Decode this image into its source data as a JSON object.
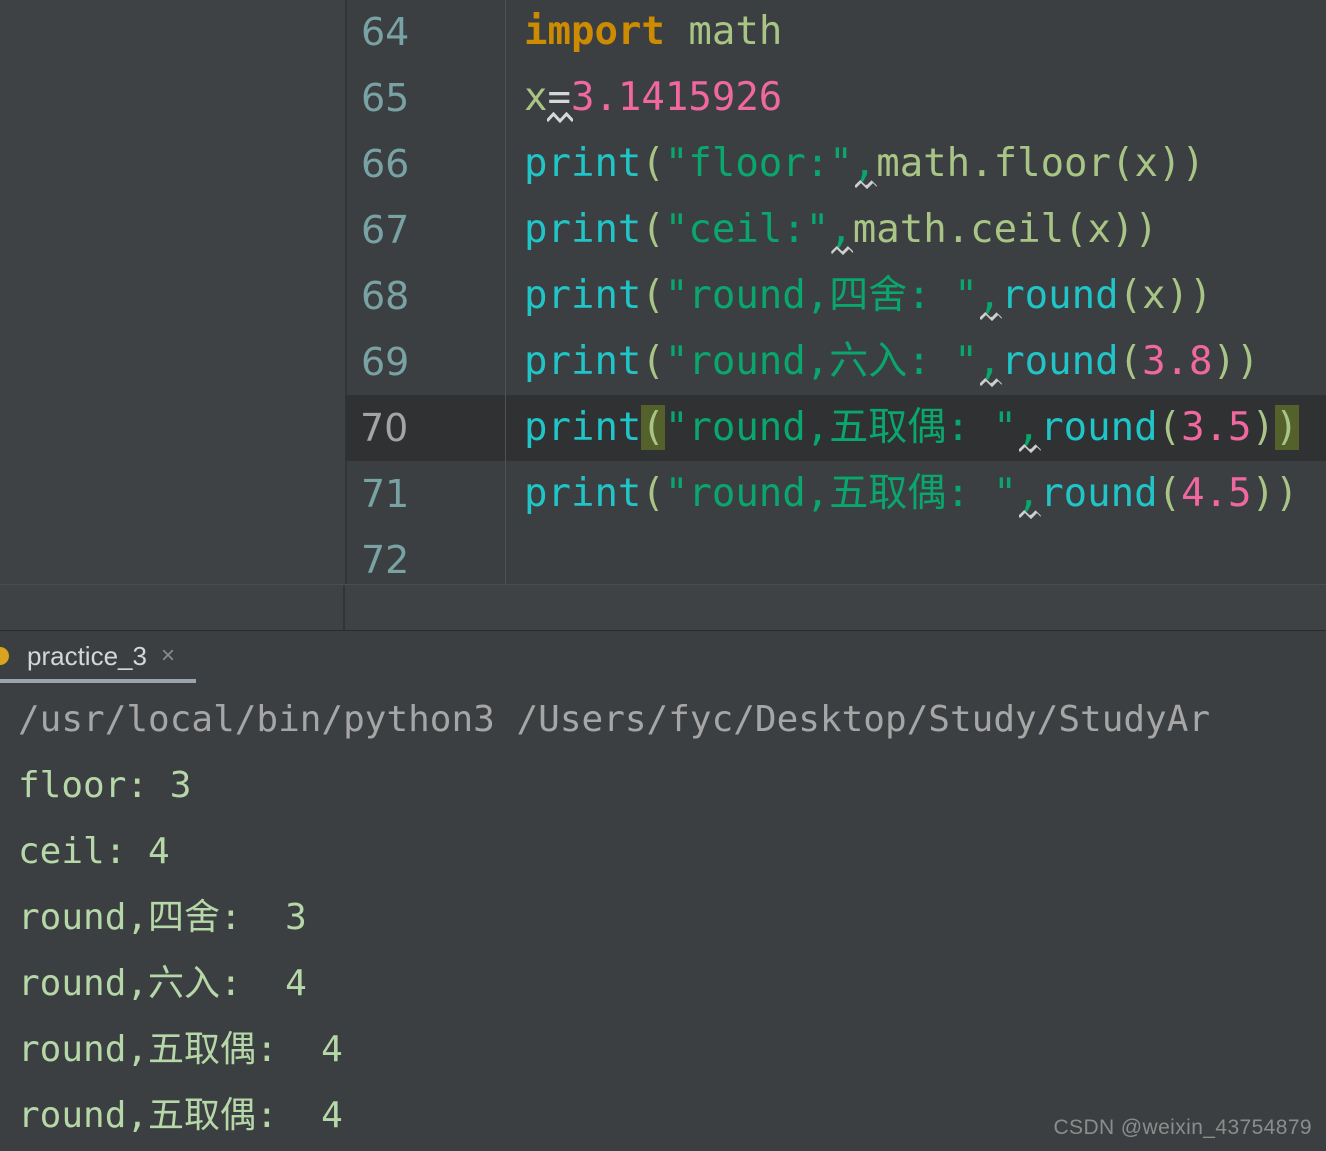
{
  "editor": {
    "lines": [
      {
        "number": "64",
        "current": false,
        "tokens": [
          {
            "text": "import",
            "cls": "t-kw"
          },
          {
            "text": " ",
            "cls": "t-op"
          },
          {
            "text": "math",
            "cls": "t-ident"
          }
        ]
      },
      {
        "number": "65",
        "current": false,
        "tokens": [
          {
            "text": "x",
            "cls": "t-ident"
          },
          {
            "text": "=",
            "cls": "t-op",
            "squiggle": "white"
          },
          {
            "text": "3.1415926",
            "cls": "t-num"
          }
        ]
      },
      {
        "number": "66",
        "current": false,
        "tokens": [
          {
            "text": "print",
            "cls": "t-fn"
          },
          {
            "text": "(",
            "cls": "t-punct"
          },
          {
            "text": "\"floor:\"",
            "cls": "t-str"
          },
          {
            "text": ",",
            "cls": "t-str",
            "squiggle": "orange"
          },
          {
            "text": "math.floor",
            "cls": "t-ident"
          },
          {
            "text": "(x))",
            "cls": "t-ident"
          }
        ]
      },
      {
        "number": "67",
        "current": false,
        "tokens": [
          {
            "text": "print",
            "cls": "t-fn"
          },
          {
            "text": "(",
            "cls": "t-punct"
          },
          {
            "text": "\"ceil:\"",
            "cls": "t-str"
          },
          {
            "text": ",",
            "cls": "t-str",
            "squiggle": "orange"
          },
          {
            "text": "math.ceil",
            "cls": "t-ident"
          },
          {
            "text": "(x))",
            "cls": "t-ident"
          }
        ]
      },
      {
        "number": "68",
        "current": false,
        "tokens": [
          {
            "text": "print",
            "cls": "t-fn"
          },
          {
            "text": "(",
            "cls": "t-punct"
          },
          {
            "text": "\"round,四舍: \"",
            "cls": "t-str"
          },
          {
            "text": ",",
            "cls": "t-str",
            "squiggle": "orange"
          },
          {
            "text": "round",
            "cls": "t-fn"
          },
          {
            "text": "(",
            "cls": "t-punct"
          },
          {
            "text": "x",
            "cls": "t-ident"
          },
          {
            "text": "))",
            "cls": "t-punct"
          }
        ]
      },
      {
        "number": "69",
        "current": false,
        "tokens": [
          {
            "text": "print",
            "cls": "t-fn"
          },
          {
            "text": "(",
            "cls": "t-punct"
          },
          {
            "text": "\"round,六入: \"",
            "cls": "t-str"
          },
          {
            "text": ",",
            "cls": "t-str",
            "squiggle": "orange"
          },
          {
            "text": "round",
            "cls": "t-fn"
          },
          {
            "text": "(",
            "cls": "t-punct"
          },
          {
            "text": "3.8",
            "cls": "t-num"
          },
          {
            "text": "))",
            "cls": "t-punct"
          }
        ]
      },
      {
        "number": "70",
        "current": true,
        "tokens": [
          {
            "text": "print",
            "cls": "t-fn"
          },
          {
            "text": "(",
            "cls": "t-punct t-match"
          },
          {
            "text": "\"round,五取偶: \"",
            "cls": "t-str"
          },
          {
            "text": ",",
            "cls": "t-str",
            "squiggle": "orange"
          },
          {
            "text": "round",
            "cls": "t-fn"
          },
          {
            "text": "(",
            "cls": "t-punct"
          },
          {
            "text": "3.5",
            "cls": "t-num"
          },
          {
            "text": ")",
            "cls": "t-punct"
          },
          {
            "text": ")",
            "cls": "t-punct t-match"
          }
        ]
      },
      {
        "number": "71",
        "current": false,
        "tokens": [
          {
            "text": "print",
            "cls": "t-fn"
          },
          {
            "text": "(",
            "cls": "t-punct"
          },
          {
            "text": "\"round,五取偶: \"",
            "cls": "t-str"
          },
          {
            "text": ",",
            "cls": "t-str",
            "squiggle": "orange"
          },
          {
            "text": "round",
            "cls": "t-fn"
          },
          {
            "text": "(",
            "cls": "t-punct"
          },
          {
            "text": "4.5",
            "cls": "t-num"
          },
          {
            "text": "))",
            "cls": "t-punct"
          }
        ]
      },
      {
        "number": "72",
        "current": false,
        "tokens": []
      }
    ]
  },
  "console": {
    "tab": {
      "label": "practice_3",
      "close_label": "×",
      "run_indicator": "run-status-dot",
      "accent_color": "#d9a521",
      "underline_color": "#9aa3b0"
    },
    "output": [
      {
        "text": "/usr/local/bin/python3 /Users/fyc/Desktop/Study/StudyAr",
        "cls": "out-cmd"
      },
      {
        "text": "floor: 3",
        "cls": "out-res"
      },
      {
        "text": "ceil: 4",
        "cls": "out-res"
      },
      {
        "text": "round,四舍:  3",
        "cls": "out-res"
      },
      {
        "text": "round,六入:  4",
        "cls": "out-res"
      },
      {
        "text": "round,五取偶:  4",
        "cls": "out-res"
      },
      {
        "text": "round,五取偶:  4",
        "cls": "out-res"
      }
    ]
  },
  "watermark": {
    "text": "CSDN @weixin_43754879"
  },
  "theme": {
    "editor_bg": "#3c3f41",
    "current_line_bg": "#2f3133",
    "gutter_fg": "#78a2a4",
    "keyword": "#cc8b00",
    "function": "#20c5c7",
    "string": "#09a66d",
    "number": "#f0689f",
    "identifier": "#a9c586",
    "brace_match": "#54612a",
    "console_result": "#b6d7a8",
    "console_command": "#a6a6a6"
  }
}
